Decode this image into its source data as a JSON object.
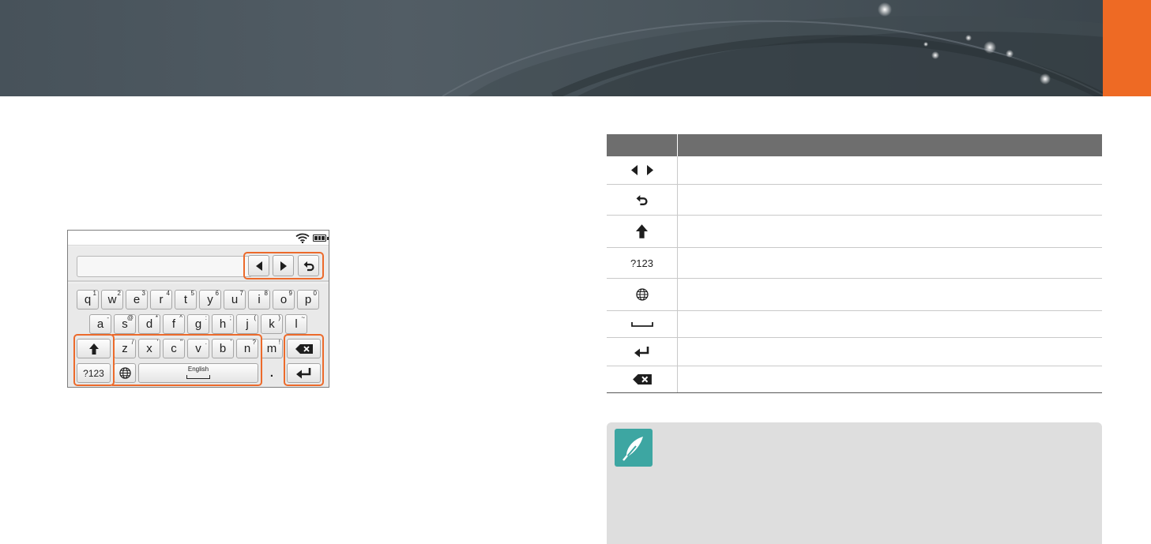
{
  "keyboard": {
    "row1": [
      {
        "char": "q",
        "sup": "1"
      },
      {
        "char": "w",
        "sup": "2"
      },
      {
        "char": "e",
        "sup": "3"
      },
      {
        "char": "r",
        "sup": "4"
      },
      {
        "char": "t",
        "sup": "5"
      },
      {
        "char": "y",
        "sup": "6"
      },
      {
        "char": "u",
        "sup": "7"
      },
      {
        "char": "i",
        "sup": "8"
      },
      {
        "char": "o",
        "sup": "9"
      },
      {
        "char": "p",
        "sup": "0"
      }
    ],
    "row2": [
      {
        "char": "a",
        "sup": "-"
      },
      {
        "char": "s",
        "sup": "@"
      },
      {
        "char": "d",
        "sup": "*"
      },
      {
        "char": "f",
        "sup": "^"
      },
      {
        "char": "g",
        "sup": ":"
      },
      {
        "char": "h",
        "sup": ";"
      },
      {
        "char": "j",
        "sup": "("
      },
      {
        "char": "k",
        "sup": ")"
      },
      {
        "char": "l",
        "sup": "~"
      }
    ],
    "row3": [
      {
        "char": "z",
        "sup": "/"
      },
      {
        "char": "x",
        "sup": "'"
      },
      {
        "char": "c",
        "sup": "\""
      },
      {
        "char": "v",
        "sup": "."
      },
      {
        "char": "b",
        "sup": "'"
      },
      {
        "char": "n",
        "sup": "?"
      },
      {
        "char": "m",
        "sup": "!"
      }
    ],
    "mode_key_label": "?123",
    "space_key_label": "English",
    "period_key_label": "."
  },
  "icons": {
    "status": [
      "wifi-icon",
      "battery-icon"
    ],
    "accent_color": "#ee6a24",
    "highlight_color": "#ec6a2b",
    "note_icon_color": "#3da6a2"
  },
  "table": {
    "header": [
      "",
      ""
    ],
    "rows": [
      {
        "icon": "arrow-left-right-icon",
        "label": ""
      },
      {
        "icon": "undo-icon",
        "label": ""
      },
      {
        "icon": "shift-arrow-icon",
        "label": ""
      },
      {
        "icon": "",
        "label": "?123"
      },
      {
        "icon": "globe-icon",
        "label": ""
      },
      {
        "icon": "space-icon",
        "label": ""
      },
      {
        "icon": "enter-icon",
        "label": ""
      },
      {
        "icon": "backspace-icon",
        "label": ""
      }
    ]
  }
}
